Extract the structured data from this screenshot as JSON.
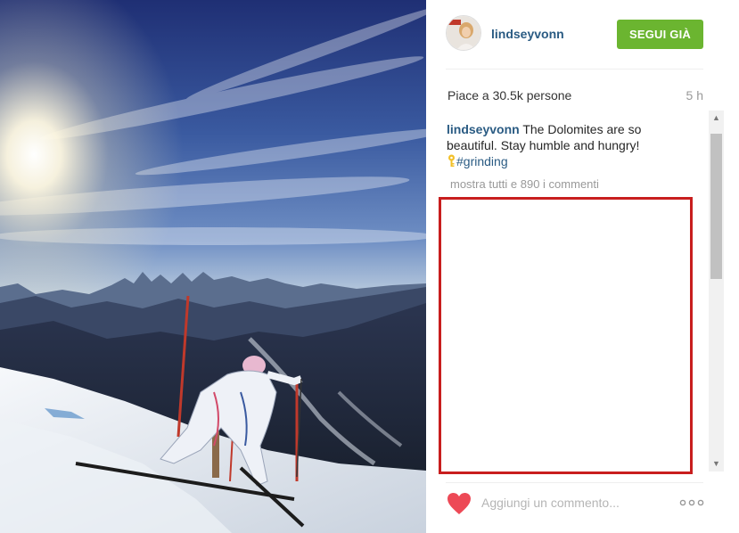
{
  "post": {
    "username": "lindseyvonn",
    "follow_label": "SEGUI GIÀ",
    "likes_text": "Piace a 30.5k persone",
    "time_ago": "5 h",
    "caption": {
      "user": "lindseyvonn",
      "text": " The Dolomites are so beautiful. Stay humble and hungry! ",
      "hashtag": "#grinding"
    },
    "show_all_comments": "mostra tutti e 890 i commenti",
    "comment_placeholder": "Aggiungi un commento..."
  },
  "icons": {
    "heart": "heart-icon",
    "more": "more-options-icon",
    "key": "key-emoji-icon"
  },
  "colors": {
    "username": "#2a5b83",
    "follow_button": "#6bb530",
    "heart": "#ed4956",
    "highlight_border": "#c81e1e"
  }
}
